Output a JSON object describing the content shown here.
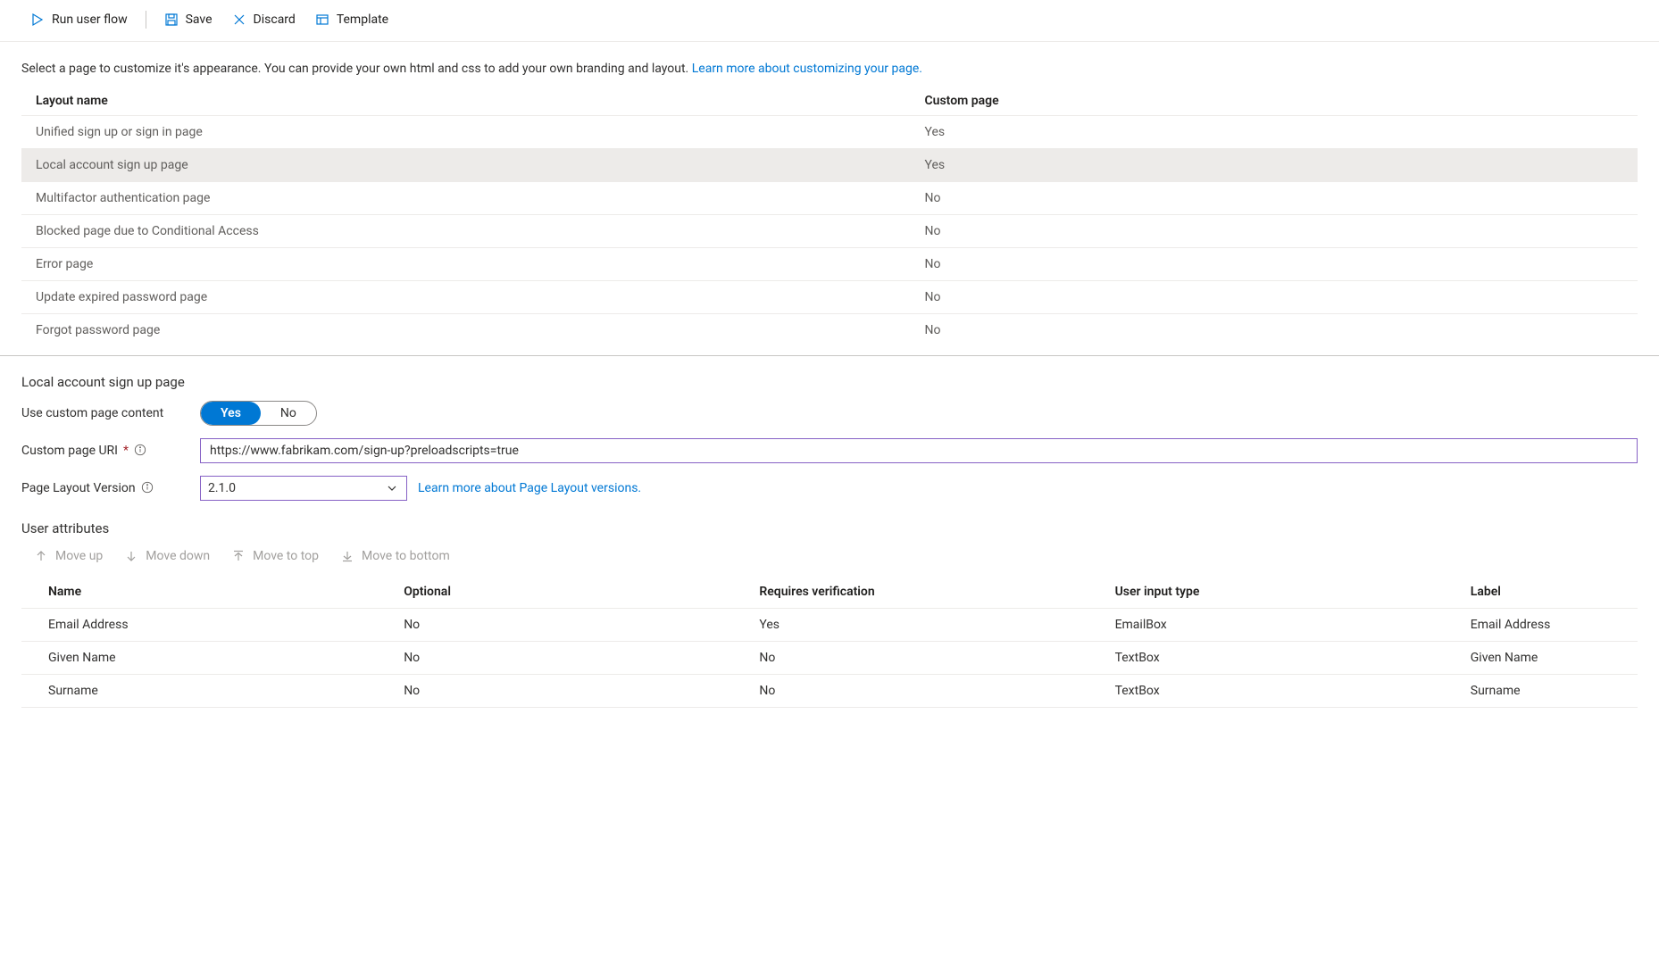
{
  "toolbar": {
    "run": "Run user flow",
    "save": "Save",
    "discard": "Discard",
    "template": "Template"
  },
  "description": {
    "text": "Select a page to customize it's appearance. You can provide your own html and css to add your own branding and layout. ",
    "link": "Learn more about customizing your page."
  },
  "layouts": {
    "headers": {
      "name": "Layout name",
      "custom": "Custom page"
    },
    "rows": [
      {
        "name": "Unified sign up or sign in page",
        "custom": "Yes",
        "selected": false
      },
      {
        "name": "Local account sign up page",
        "custom": "Yes",
        "selected": true
      },
      {
        "name": "Multifactor authentication page",
        "custom": "No",
        "selected": false
      },
      {
        "name": "Blocked page due to Conditional Access",
        "custom": "No",
        "selected": false
      },
      {
        "name": "Error page",
        "custom": "No",
        "selected": false
      },
      {
        "name": "Update expired password page",
        "custom": "No",
        "selected": false
      },
      {
        "name": "Forgot password page",
        "custom": "No",
        "selected": false
      }
    ]
  },
  "detail": {
    "title": "Local account sign up page",
    "use_custom_label": "Use custom page content",
    "toggle": {
      "yes": "Yes",
      "no": "No"
    },
    "uri_label": "Custom page URI",
    "uri_value": "https://www.fabrikam.com/sign-up?preloadscripts=true",
    "version_label": "Page Layout Version",
    "version_value": "2.1.0",
    "version_link": "Learn more about Page Layout versions.",
    "attributes_title": "User attributes",
    "move": {
      "up": "Move up",
      "down": "Move down",
      "top": "Move to top",
      "bottom": "Move to bottom"
    },
    "attr_headers": {
      "name": "Name",
      "optional": "Optional",
      "verify": "Requires verification",
      "input": "User input type",
      "label": "Label"
    },
    "attrs": [
      {
        "name": "Email Address",
        "optional": "No",
        "verify": "Yes",
        "input": "EmailBox",
        "label": "Email Address"
      },
      {
        "name": "Given Name",
        "optional": "No",
        "verify": "No",
        "input": "TextBox",
        "label": "Given Name"
      },
      {
        "name": "Surname",
        "optional": "No",
        "verify": "No",
        "input": "TextBox",
        "label": "Surname"
      }
    ]
  }
}
